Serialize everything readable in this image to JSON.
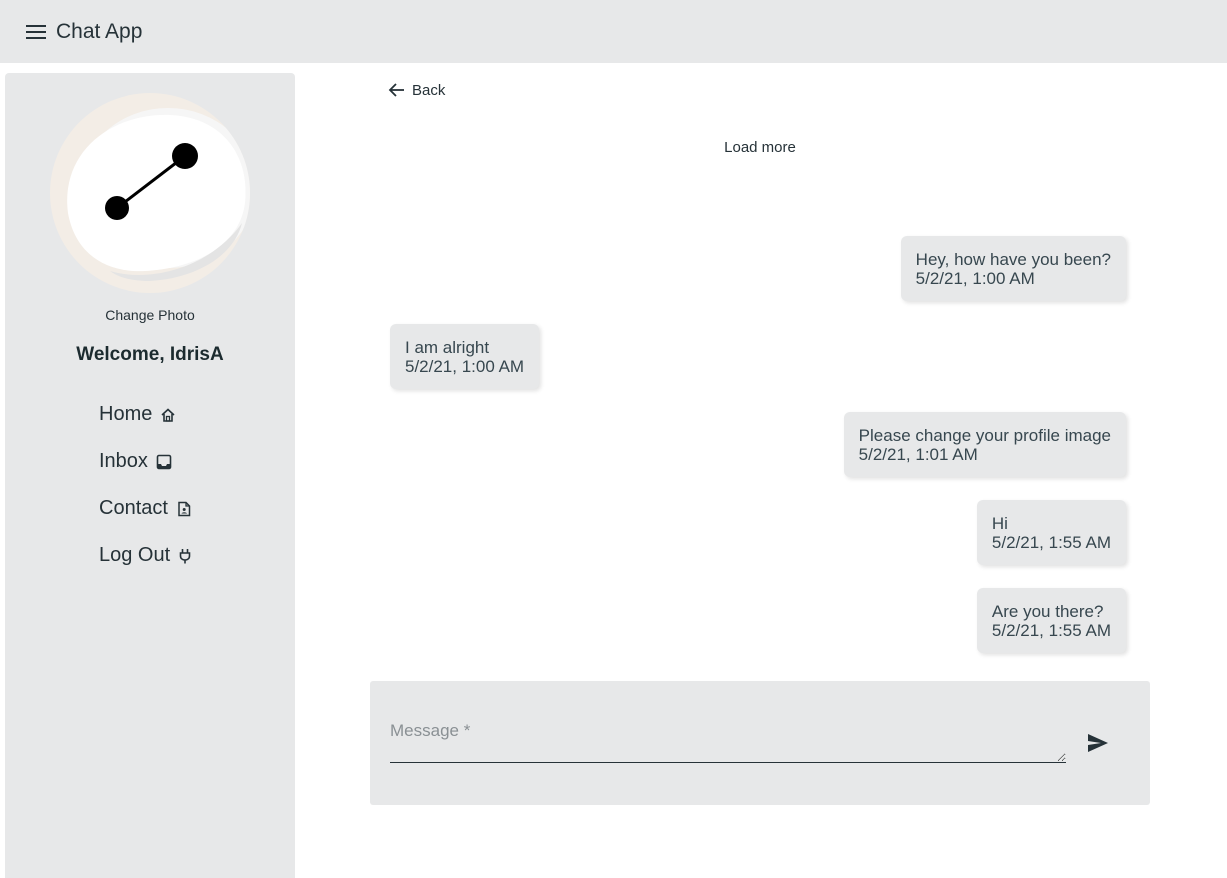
{
  "app": {
    "title": "Chat App"
  },
  "sidebar": {
    "change_photo": "Change Photo",
    "welcome": "Welcome, IdrisA",
    "items": [
      {
        "label": "Home",
        "icon": "home-icon"
      },
      {
        "label": "Inbox",
        "icon": "inbox-icon"
      },
      {
        "label": "Contact",
        "icon": "contact-icon"
      },
      {
        "label": "Log Out",
        "icon": "plug-icon"
      }
    ]
  },
  "chat": {
    "back_label": "Back",
    "load_more": "Load more",
    "messages": [
      {
        "side": "right",
        "text": "Hey, how have you been?",
        "time": "5/2/21, 1:00 AM"
      },
      {
        "side": "left",
        "text": "I am alright",
        "time": "5/2/21, 1:00 AM"
      },
      {
        "side": "right",
        "text": "Please change your profile image",
        "time": "5/2/21, 1:01 AM"
      },
      {
        "side": "right",
        "text": "Hi",
        "time": "5/2/21, 1:55 AM"
      },
      {
        "side": "right",
        "text": "Are you there?",
        "time": "5/2/21, 1:55 AM"
      }
    ],
    "composer": {
      "placeholder": "Message *",
      "value": ""
    }
  },
  "colors": {
    "panel_bg": "#e7e8e9",
    "text": "#263238"
  }
}
